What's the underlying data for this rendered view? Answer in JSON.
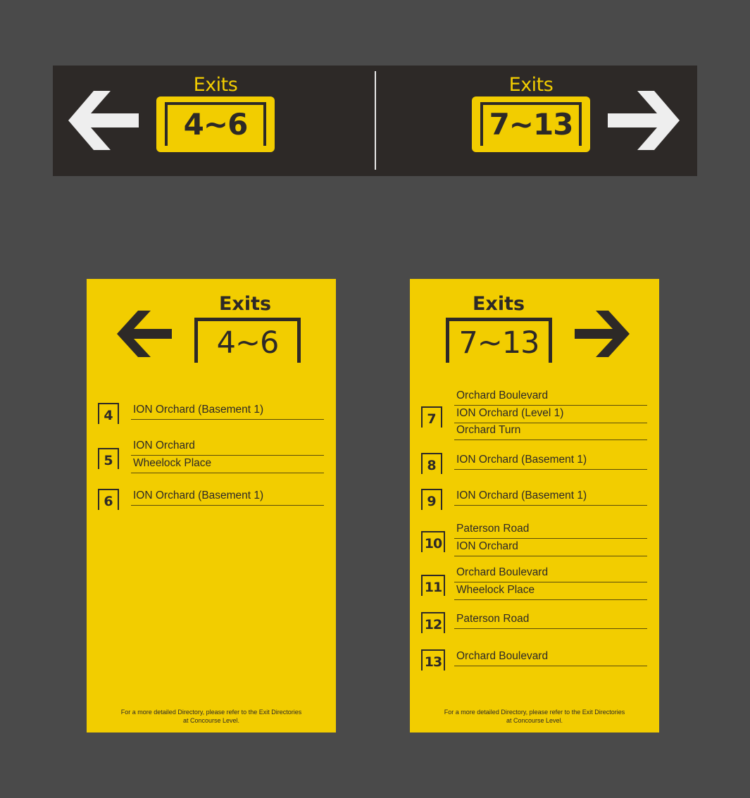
{
  "overhead": {
    "left": {
      "heading": "Exits",
      "range": "4~6",
      "arrow_icon": "arrow-left-icon"
    },
    "right": {
      "heading": "Exits",
      "range": "7~13",
      "arrow_icon": "arrow-right-icon"
    }
  },
  "panel_left": {
    "heading": "Exits",
    "range": "4~6",
    "arrow_icon": "arrow-left-icon",
    "exits": [
      {
        "number": "4",
        "destinations": [
          "ION Orchard (Basement 1)"
        ]
      },
      {
        "number": "5",
        "destinations": [
          "ION Orchard",
          "Wheelock Place"
        ]
      },
      {
        "number": "6",
        "destinations": [
          "ION Orchard (Basement 1)"
        ]
      }
    ],
    "footer_line1": "For a more detailed Directory, please refer to the Exit Directories",
    "footer_line2": "at Concourse Level."
  },
  "panel_right": {
    "heading": "Exits",
    "range": "7~13",
    "arrow_icon": "arrow-right-icon",
    "exits": [
      {
        "number": "7",
        "destinations": [
          "Orchard Boulevard",
          "ION Orchard (Level 1)",
          "Orchard Turn"
        ]
      },
      {
        "number": "8",
        "destinations": [
          "ION Orchard (Basement 1)"
        ]
      },
      {
        "number": "9",
        "destinations": [
          "ION Orchard (Basement 1)"
        ]
      },
      {
        "number": "10",
        "destinations": [
          "Paterson Road",
          "ION Orchard"
        ]
      },
      {
        "number": "11",
        "destinations": [
          "Orchard Boulevard",
          "Wheelock Place"
        ]
      },
      {
        "number": "12",
        "destinations": [
          "Paterson Road"
        ]
      },
      {
        "number": "13",
        "destinations": [
          "Orchard Boulevard"
        ]
      }
    ],
    "footer_line1": "For a more detailed Directory, please refer to the Exit Directories",
    "footer_line2": "at Concourse Level."
  },
  "colors": {
    "background": "#4a4a4a",
    "sign_dark": "#2d2927",
    "sign_yellow": "#f2cd00",
    "arrow_white": "#eeeeee"
  }
}
